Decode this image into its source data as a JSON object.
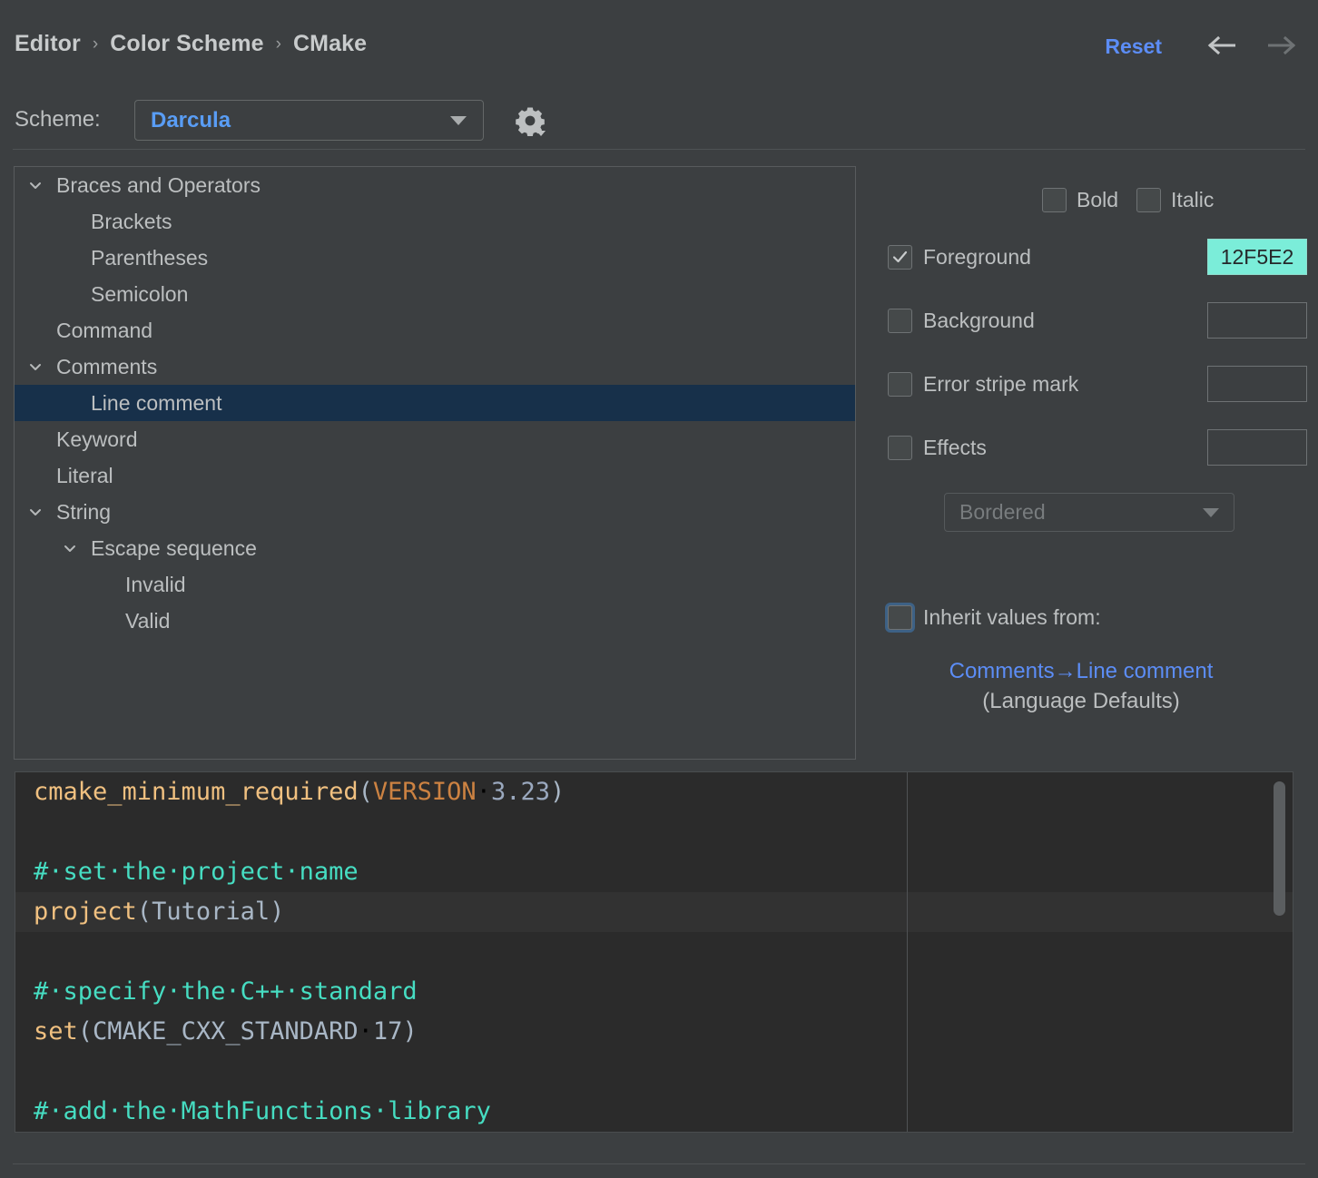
{
  "header": {
    "breadcrumb": [
      "Editor",
      "Color Scheme",
      "CMake"
    ],
    "separator": "›",
    "reset_label": "Reset",
    "back_icon": "arrow-left-icon",
    "forward_icon": "arrow-right-icon"
  },
  "scheme": {
    "label": "Scheme:",
    "value": "Darcula",
    "gear_icon": "gear-dropdown-icon"
  },
  "tree": {
    "items": [
      {
        "label": "Braces and Operators",
        "indent": 0,
        "twisty": "expanded",
        "selected": false
      },
      {
        "label": "Brackets",
        "indent": 1,
        "twisty": "none",
        "selected": false
      },
      {
        "label": "Parentheses",
        "indent": 1,
        "twisty": "none",
        "selected": false
      },
      {
        "label": "Semicolon",
        "indent": 1,
        "twisty": "none",
        "selected": false
      },
      {
        "label": "Command",
        "indent": 0,
        "twisty": "none",
        "selected": false
      },
      {
        "label": "Comments",
        "indent": 0,
        "twisty": "expanded",
        "selected": false
      },
      {
        "label": "Line comment",
        "indent": 1,
        "twisty": "none",
        "selected": true
      },
      {
        "label": "Keyword",
        "indent": 0,
        "twisty": "none",
        "selected": false
      },
      {
        "label": "Literal",
        "indent": 0,
        "twisty": "none",
        "selected": false
      },
      {
        "label": "String",
        "indent": 0,
        "twisty": "expanded",
        "selected": false
      },
      {
        "label": "Escape sequence",
        "indent": 1,
        "twisty": "expanded",
        "selected": false
      },
      {
        "label": "Invalid",
        "indent": 2,
        "twisty": "none",
        "selected": false
      },
      {
        "label": "Valid",
        "indent": 2,
        "twisty": "none",
        "selected": false
      }
    ]
  },
  "attributes": {
    "bold": {
      "label": "Bold",
      "checked": false
    },
    "italic": {
      "label": "Italic",
      "checked": false
    },
    "foreground": {
      "label": "Foreground",
      "checked": true,
      "value": "12F5E2",
      "color": "#7BEDD9"
    },
    "background": {
      "label": "Background",
      "checked": false,
      "value": ""
    },
    "error_stripe_mark": {
      "label": "Error stripe mark",
      "checked": false,
      "value": ""
    },
    "effects": {
      "label": "Effects",
      "checked": false,
      "value": ""
    },
    "effect_type": {
      "value": "Bordered"
    },
    "inherit": {
      "label": "Inherit values from:",
      "checked": false,
      "link": "Comments→Line comment",
      "sublabel": "(Language Defaults)"
    }
  },
  "preview": {
    "lines": [
      {
        "highlight": false,
        "tokens": [
          {
            "t": "cmake_minimum_required",
            "c": "fn"
          },
          {
            "t": "(",
            "c": "id"
          },
          {
            "t": "VERSION",
            "c": "kw"
          },
          {
            "t": "·",
            "c": "dot"
          },
          {
            "t": "3.23",
            "c": "num"
          },
          {
            "t": ")",
            "c": "id"
          }
        ]
      },
      {
        "highlight": false,
        "tokens": []
      },
      {
        "highlight": false,
        "tokens": [
          {
            "t": "#·set·the·project·name",
            "c": "cmt"
          }
        ]
      },
      {
        "highlight": true,
        "tokens": [
          {
            "t": "project",
            "c": "fn"
          },
          {
            "t": "(",
            "c": "id"
          },
          {
            "t": "Tutorial",
            "c": "id"
          },
          {
            "t": ")",
            "c": "id"
          }
        ]
      },
      {
        "highlight": false,
        "tokens": []
      },
      {
        "highlight": false,
        "tokens": [
          {
            "t": "#·specify·the·C++·standard",
            "c": "cmt"
          }
        ]
      },
      {
        "highlight": false,
        "tokens": [
          {
            "t": "set",
            "c": "fn"
          },
          {
            "t": "(",
            "c": "id"
          },
          {
            "t": "CMAKE_CXX_STANDARD",
            "c": "id"
          },
          {
            "t": "·",
            "c": "dot"
          },
          {
            "t": "17",
            "c": "id"
          },
          {
            "t": ")",
            "c": "id"
          }
        ]
      },
      {
        "highlight": false,
        "tokens": []
      },
      {
        "highlight": false,
        "tokens": [
          {
            "t": "#·add·the·MathFunctions·library",
            "c": "cmt"
          }
        ]
      }
    ],
    "scrollbar_icon": "vertical-scrollbar"
  },
  "colors": {
    "accent_blue": "#5C8DF6",
    "selection_navy": "#17304A",
    "panel_bg": "#3C3F41",
    "editor_bg": "#2B2B2B",
    "foreground_swatch": "#7BEDD9"
  }
}
